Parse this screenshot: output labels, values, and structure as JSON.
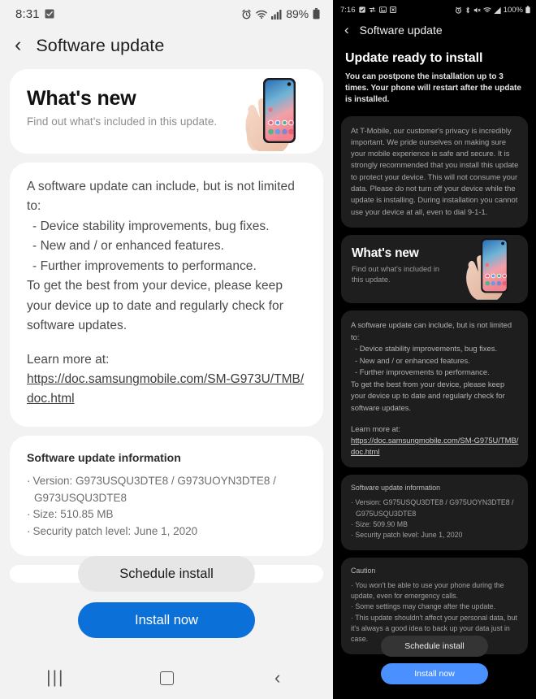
{
  "light_phone": {
    "status_bar": {
      "time": "8:31",
      "left_icons": [
        "checkbox-icon"
      ],
      "right_icons": [
        "alarm-icon",
        "wifi-icon",
        "signal-icon"
      ],
      "battery_percent": "89%",
      "battery_icon": "battery-icon"
    },
    "app_bar": {
      "back_icon": "back-chevron-icon",
      "title": "Software update"
    },
    "whats_new": {
      "title": "What's new",
      "subtitle": "Find out what's included in this update.",
      "image": "hand-holding-phone-illustration"
    },
    "body": {
      "intro": "A software update can include, but is not limited to:",
      "bullets": [
        "- Device stability improvements, bug fixes.",
        "- New and / or enhanced features.",
        "- Further improvements to performance."
      ],
      "outro": "To get the best from your device, please keep your device up to date and regularly check for software updates.",
      "learn_more_label": "Learn more at:",
      "learn_more_url": "https://doc.samsungmobile.com/SM-G973U/TMB/doc.html"
    },
    "info": {
      "heading": "Software update information",
      "version_label": "Version: G973USQU3DTE8 / G973UOYN3DTE8 /",
      "version_cont": "G973USQU3DTE8",
      "size": "Size: 510.85 MB",
      "security": "Security patch level: June 1, 2020",
      "bullet": "·"
    },
    "buttons": {
      "schedule": "Schedule install",
      "install": "Install now"
    },
    "nav_bar": {
      "recents_icon": "recents-icon",
      "home_icon": "home-icon",
      "back_icon": "back-icon"
    }
  },
  "dark_phone": {
    "status_bar": {
      "time": "7:16",
      "left_icons": [
        "checkbox-icon",
        "swap-icon",
        "image-icon",
        "screenshot-icon"
      ],
      "right_icons": [
        "alarm-icon",
        "bluetooth-icon",
        "mute-icon",
        "wifi-icon",
        "signal-icon"
      ],
      "battery_percent": "100%",
      "battery_icon": "battery-icon"
    },
    "app_bar": {
      "back_icon": "back-chevron-icon",
      "title": "Software update"
    },
    "header": {
      "title": "Update ready to install",
      "subtitle": "You can postpone the installation up to 3 times. Your phone will restart after the update is installed."
    },
    "carrier_notice": "At T-Mobile, our customer's privacy is incredibly important. We pride ourselves on making sure your mobile experience is safe and secure. It is strongly recommended that you install this update to protect your device. This will not consume your data. Please do not turn off your device while the update is installing. During installation you cannot use your device at all, even to dial 9-1-1.",
    "whats_new": {
      "title": "What's new",
      "subtitle": "Find out what's included in this update.",
      "image": "hand-holding-phone-illustration"
    },
    "body": {
      "intro": "A software update can include, but is not limited to:",
      "bullets": [
        "- Device stability improvements, bug fixes.",
        "- New and / or enhanced features.",
        "- Further improvements to performance."
      ],
      "outro": "To get the best from your device, please keep your device up to date and regularly check for software updates.",
      "learn_more_label": "Learn more at:",
      "learn_more_url": "https://doc.samsungmobile.com/SM-G975U/TMB/doc.html"
    },
    "info": {
      "heading": "Software update information",
      "version_label": "Version: G975USQU3DTE8 / G975UOYN3DTE8 /",
      "version_cont": "G975USQU3DTE8",
      "size": "Size: 509.90 MB",
      "security": "Security patch level: June 1, 2020",
      "bullet": "·"
    },
    "caution": {
      "heading": "Caution",
      "items": [
        "You won't be able to use your phone during the update, even for emergency calls.",
        "Some settings may change after the update.",
        "This update shouldn't affect your personal data, but it's always a good idea to back up your data just in case."
      ],
      "bullet": "·"
    },
    "buttons": {
      "schedule": "Schedule install",
      "install": "Install now"
    }
  },
  "colors": {
    "light_bg": "#f2f2f2",
    "card_bg": "#ffffff",
    "install_blue": "#0b71d8",
    "dark_bg": "#000000",
    "dark_card": "#1e1e1e",
    "dark_install_blue": "#4a90ff"
  }
}
